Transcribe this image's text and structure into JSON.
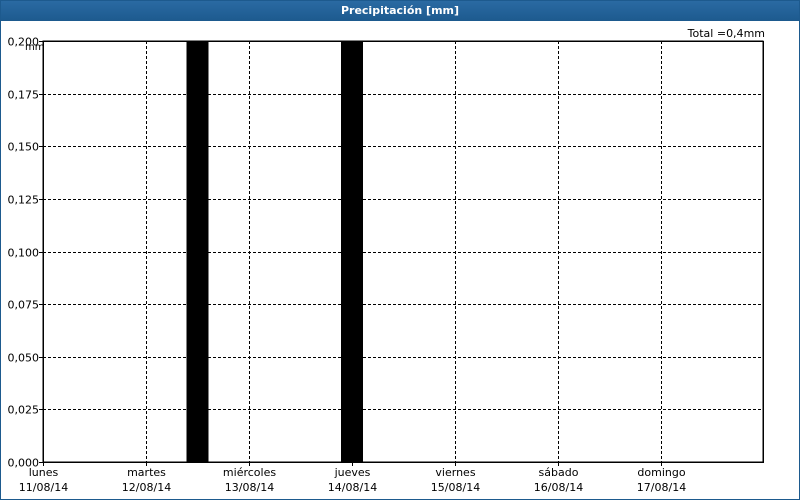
{
  "window": {
    "title": "Precipitación [mm]"
  },
  "total": {
    "label": "Total =",
    "value": "0,4",
    "unit": "mm"
  },
  "colors": {
    "title_bar": "#1d5a8e",
    "bars": "#000000",
    "grid": "#000000"
  },
  "chart_data": {
    "type": "bar",
    "title": "Precipitación [mm]",
    "ylabel": "mm",
    "ylim": [
      0,
      0.2
    ],
    "yticks": [
      "0,000",
      "0,025",
      "0,050",
      "0,075",
      "0,100",
      "0,125",
      "0,150",
      "0,175",
      "0,200"
    ],
    "grid": true,
    "days": [
      {
        "name": "lunes",
        "date": "11/08/14"
      },
      {
        "name": "martes",
        "date": "12/08/14"
      },
      {
        "name": "miércoles",
        "date": "13/08/14"
      },
      {
        "name": "jueves",
        "date": "14/08/14"
      },
      {
        "name": "viernes",
        "date": "15/08/14"
      },
      {
        "name": "sábado",
        "date": "16/08/14"
      },
      {
        "name": "domingo",
        "date": "17/08/14"
      }
    ],
    "series": [
      {
        "points": [
          {
            "x": "12/08/14 12:00",
            "y": 0.2
          },
          {
            "x": "14/08/14 00:00",
            "y": 0.2
          }
        ]
      }
    ]
  }
}
